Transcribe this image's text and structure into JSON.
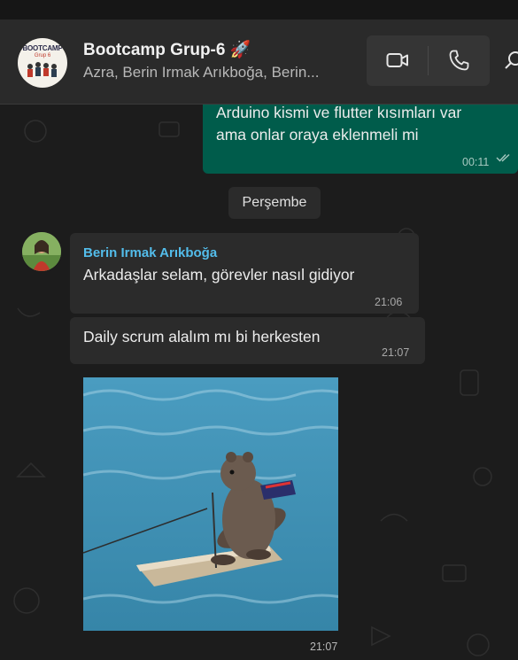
{
  "header": {
    "title": "Bootcamp Grup-6 🚀",
    "participants": "Azra, Berin Irmak Arıkboğa, Berin...",
    "avatar_logo_text": "BOOTCAMP",
    "avatar_logo_sub": "Grup 6",
    "video_icon": "video-camera-icon",
    "call_icon": "phone-icon",
    "search_icon": "search-icon"
  },
  "messages": {
    "outgoing": {
      "line1": "Arduino kismi ve flutter kısımları var",
      "line2": "ama onlar oraya eklenmeli mi",
      "time": "00:11",
      "status_icon": "double-check-icon"
    },
    "date_separator": "Perşembe",
    "incoming_1": {
      "sender": "Berin Irmak Arıkboğa",
      "text": "Arkadaşlar selam, görevler nasıl gidiyor",
      "time": "21:06"
    },
    "incoming_2": {
      "text": "Daily scrum alalım mı bi herkesten",
      "time": "21:07"
    },
    "incoming_media": {
      "description_icon": "squirrel-water-ski-gif",
      "time": "21:07"
    }
  },
  "colors": {
    "outgoing_bubble": "#005c4b",
    "incoming_bubble": "#2b2b2b",
    "sender_name": "#53bdeb",
    "header_bg": "#2a2a2a",
    "chat_bg": "#1c1c1c"
  }
}
